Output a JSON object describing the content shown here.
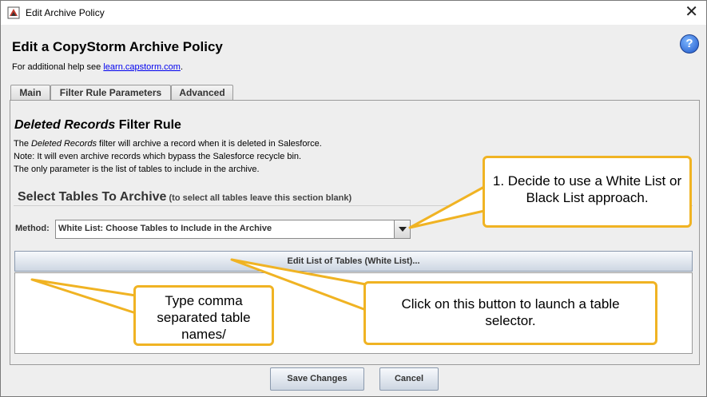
{
  "window": {
    "title": "Edit Archive Policy",
    "close_glyph": "✕"
  },
  "header": {
    "heading": "Edit a CopyStorm Archive Policy",
    "help_prefix": "For additional help see ",
    "help_link": "learn.capstorm.com",
    "help_suffix": ".",
    "help_icon_glyph": "?"
  },
  "tabs": [
    {
      "label": "Main",
      "selected": false
    },
    {
      "label": "Filter Rule Parameters",
      "selected": true
    },
    {
      "label": "Advanced",
      "selected": false
    }
  ],
  "rule": {
    "title_italic": "Deleted Records",
    "title_rest": " Filter Rule",
    "desc1_prefix": "The ",
    "desc1_italic": "Deleted Records",
    "desc1_rest": " filter will archive a record when it is deleted in Salesforce.",
    "desc2": "Note: It will even archive records which bypass the Salesforce recycle bin.",
    "desc3": "The only parameter is the list of tables to include in the archive."
  },
  "tables_section": {
    "title": "Select Tables To Archive",
    "hint": " (to select all tables leave this section blank)",
    "method_label": "Method:",
    "method_value": "White List: Choose Tables to Include in the Archive",
    "edit_button": "Edit List of Tables (White List)...",
    "textarea_value": ""
  },
  "footer": {
    "save_label": "Save Changes",
    "cancel_label": "Cancel"
  },
  "callouts": {
    "method": "1. Decide to use a White List or Black List approach.",
    "button": "Click on this button to launch a table selector.",
    "textarea": "Type comma separated table names/"
  },
  "colors": {
    "callout_border": "#f0b323",
    "link": "#0000ee",
    "help_icon": "#1e56c9"
  }
}
